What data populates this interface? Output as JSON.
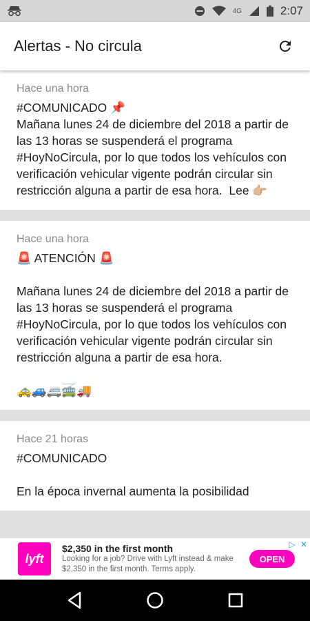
{
  "status_bar": {
    "time": "2:07",
    "network_label": "4G",
    "icons": [
      "incognito-icon",
      "do-not-disturb-icon",
      "wifi-icon",
      "signal-icon",
      "battery-icon"
    ]
  },
  "app_bar": {
    "title": "Alertas - No circula",
    "action_icon": "refresh-icon"
  },
  "alerts": [
    {
      "time": "Hace una hora",
      "body": "#COMUNICADO 📌\nMañana lunes 24 de diciembre del 2018 a partir de las 13 horas se suspenderá el programa #HoyNoCircula, por lo que todos los vehículos con verificación vehicular vigente podrán circular sin restricción alguna a partir de esa hora.  Lee 👉🏼"
    },
    {
      "time": "Hace una hora",
      "body": "🚨 ATENCIÓN 🚨\n\nMañana lunes 24 de diciembre del 2018 a partir de las 13 horas se suspenderá el programa #HoyNoCircula, por lo que todos los vehículos con verificación vehicular vigente podrán circular sin restricción alguna a partir de esa hora.\n\n🚕🚙🚐🚎🚚"
    },
    {
      "time": "Hace 21 horas",
      "body": "#COMUNICADO\n\nEn la época invernal aumenta la posibilidad"
    }
  ],
  "ad": {
    "logo_text": "lyft",
    "title": "$2,350 in the first month",
    "description": "Looking for a job? Drive with Lyft instead & make $2,350 in the first month. Terms apply.",
    "cta": "OPEN",
    "brand_color": "#ff00bf"
  },
  "nav_bar": {
    "buttons": [
      "back-icon",
      "home-icon",
      "recents-icon"
    ]
  }
}
